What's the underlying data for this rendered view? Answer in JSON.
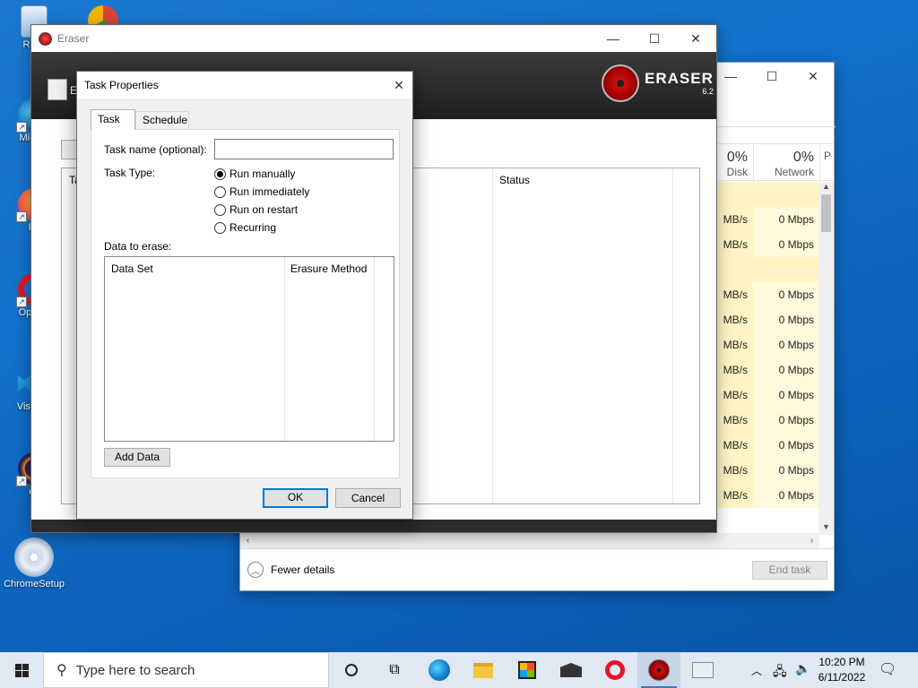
{
  "desktop": {
    "icons": [
      {
        "label": "Recy"
      },
      {
        "label": "Mic Ec"
      },
      {
        "label": "Fir"
      },
      {
        "label": "Op Bro"
      },
      {
        "label": "Visua C"
      },
      {
        "label": "ec"
      },
      {
        "label": "ChromeSetup"
      }
    ]
  },
  "task_manager": {
    "columns": [
      {
        "pct": "0%",
        "name": "Disk"
      },
      {
        "pct": "0%",
        "name": "Network"
      },
      {
        "pct": "",
        "name": "P"
      }
    ],
    "rows": [
      {
        "disk": "",
        "network": ""
      },
      {
        "disk": "MB/s",
        "network": "0 Mbps"
      },
      {
        "disk": "MB/s",
        "network": "0 Mbps"
      },
      {
        "disk": "",
        "network": ""
      },
      {
        "disk": "MB/s",
        "network": "0 Mbps"
      },
      {
        "disk": "MB/s",
        "network": "0 Mbps"
      },
      {
        "disk": "MB/s",
        "network": "0 Mbps"
      },
      {
        "disk": "MB/s",
        "network": "0 Mbps"
      },
      {
        "disk": "MB/s",
        "network": "0 Mbps"
      },
      {
        "disk": "MB/s",
        "network": "0 Mbps"
      },
      {
        "disk": "MB/s",
        "network": "0 Mbps"
      },
      {
        "disk": "MB/s",
        "network": "0 Mbps"
      },
      {
        "disk": "MB/s",
        "network": "0 Mbps"
      }
    ],
    "fewer_details": "Fewer details",
    "end_task": "End task"
  },
  "eraser": {
    "title": "Eraser",
    "logo_text": "ERASER",
    "version": "6.2",
    "header_partial": "E",
    "col_task_partial": "Ta",
    "col_status": "Status"
  },
  "dialog": {
    "title": "Task Properties",
    "tabs": [
      {
        "label": "Task"
      },
      {
        "label": "Schedule"
      }
    ],
    "task_name_label": "Task name (optional):",
    "task_name_value": "",
    "task_type_label": "Task Type:",
    "task_types": [
      {
        "label": "Run manually",
        "selected": true
      },
      {
        "label": "Run immediately",
        "selected": false
      },
      {
        "label": "Run on restart",
        "selected": false
      },
      {
        "label": "Recurring",
        "selected": false
      }
    ],
    "data_to_erase_label": "Data to erase:",
    "data_columns": [
      "Data Set",
      "Erasure Method"
    ],
    "add_data": "Add Data",
    "ok": "OK",
    "cancel": "Cancel"
  },
  "taskbar": {
    "search_placeholder": "Type here to search",
    "time": "10:20 PM",
    "date": "6/11/2022"
  },
  "colors": {
    "accent": "#0078d7",
    "eraser_dark": "#2b2b2b",
    "taskmgr_highlight": "#fff4c4"
  }
}
